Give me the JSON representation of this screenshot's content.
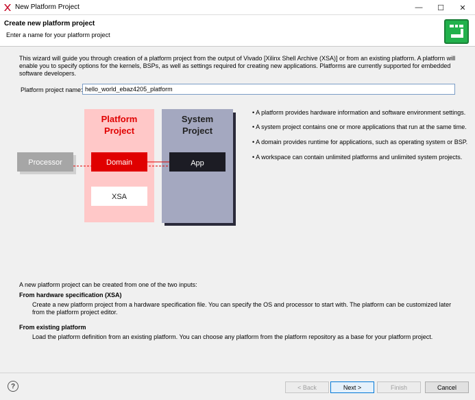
{
  "window": {
    "title": "New Platform Project",
    "minimize": "—",
    "maximize": "☐",
    "close": "✕"
  },
  "header": {
    "title": "Create new platform project",
    "subtitle": "Enter a name for your platform project"
  },
  "intro": "This wizard will guide you through creation of a platform project from the output of Vivado [Xilinx Shell Archive (XSA)] or from an existing platform. A platform will enable you to specify options for the kernels, BSPs, as well as settings required for creating new applications. Platforms are currently supported for embedded software developers.",
  "form": {
    "name_label": "Platform project name:",
    "name_value": "hello_world_ebaz4205_platform"
  },
  "diagram": {
    "processor": "Processor",
    "platform_title_1": "Platform",
    "platform_title_2": "Project",
    "domain": "Domain",
    "xsa": "XSA",
    "system_title_1": "System",
    "system_title_2": "Project",
    "app": "App"
  },
  "bullets": [
    "• A platform provides hardware information and software environment settings.",
    "• A system project contains one or more applications that run at the same time.",
    "• A domain provides runtime for applications, such as operating system or BSP.",
    "• A workspace can contain unlimited platforms and unlimited system projects."
  ],
  "inputs_text": "A new platform project can be created from one of the two inputs:",
  "from_hw": {
    "title": "From hardware specification (XSA)",
    "desc": "Create a new platform project from a hardware specification file. You can specify the OS and processor to start with. The platform can be customized later from the platform project editor."
  },
  "from_existing": {
    "title": "From existing platform",
    "desc": "Load the platform definition from an existing platform. You can choose any platform from the platform repository as a base for your platform project."
  },
  "footer": {
    "help": "?",
    "back": "< Back",
    "next": "Next >",
    "finish": "Finish",
    "cancel": "Cancel"
  },
  "colors": {
    "platform_bg": "#ffc8c8",
    "platform_title": "#e00000",
    "domain_bg": "#e00000",
    "system_bg": "#a4a8c0",
    "app_bg": "#1c1c24",
    "processor_bg": "#a6a6a6"
  }
}
